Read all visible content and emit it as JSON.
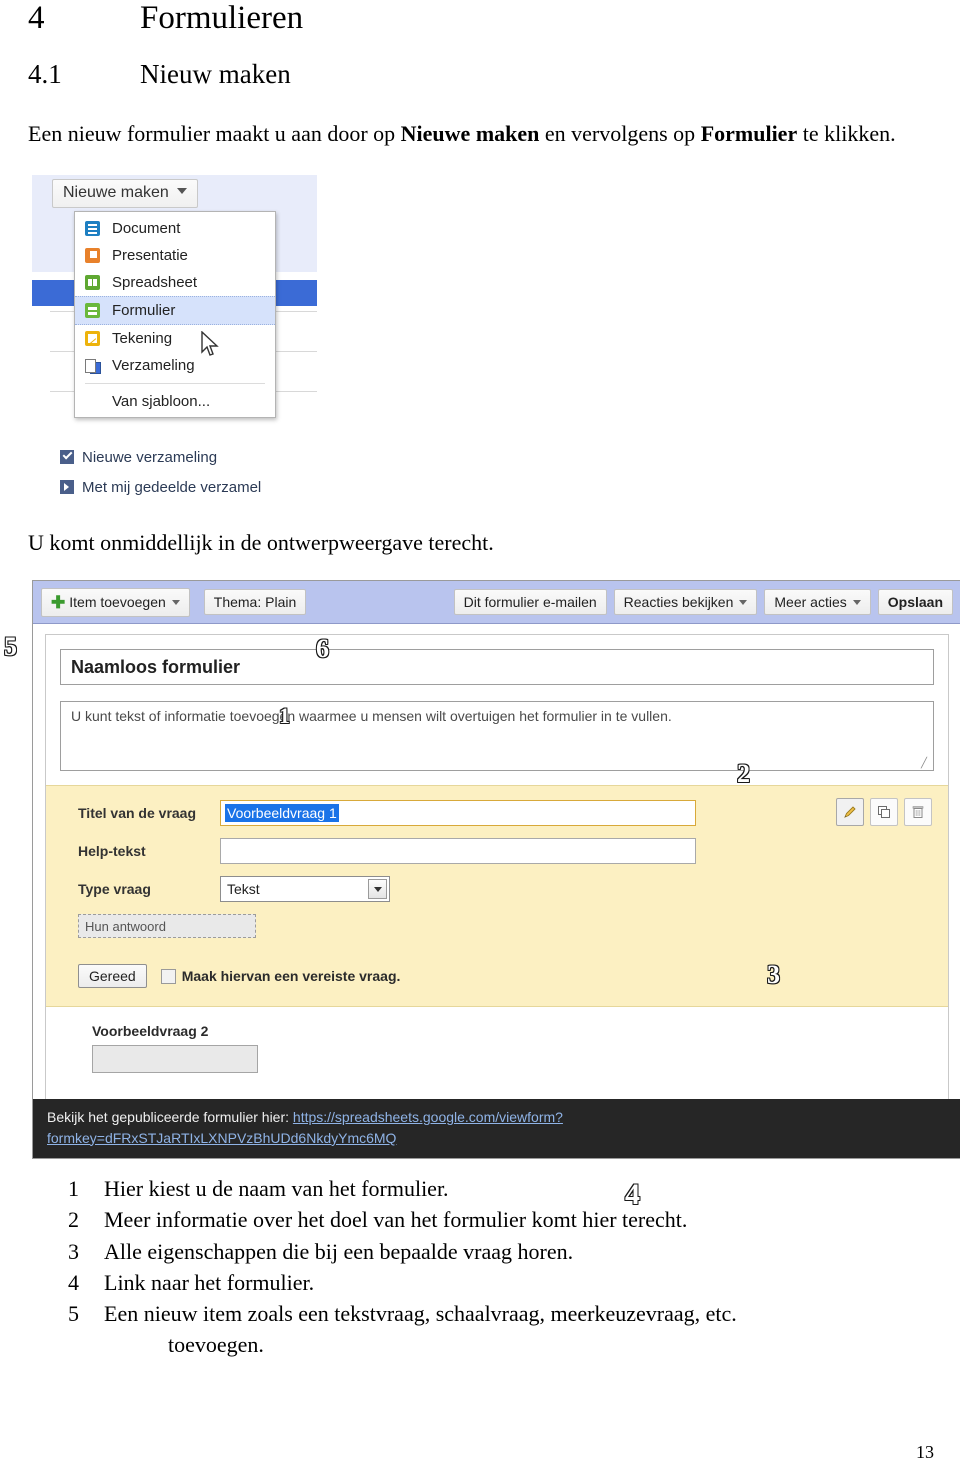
{
  "document": {
    "chapter_number": "4",
    "chapter_title": "Formulieren",
    "section_number": "4.1",
    "section_title": "Nieuw maken",
    "intro_part1": "Een nieuw formulier maakt u aan door op ",
    "intro_bold1": "Nieuwe maken",
    "intro_part2": " en vervolgens op ",
    "intro_bold2": "Formulier",
    "intro_part3": " te klikken.",
    "after_shot1": "U komt onmiddellijk in de ontwerpweergave terecht.",
    "page_number": "13"
  },
  "legend": {
    "items": [
      {
        "num": "1",
        "text": "Hier kiest u de naam van het formulier."
      },
      {
        "num": "2",
        "text": "Meer informatie over het doel van het formulier komt hier terecht."
      },
      {
        "num": "3",
        "text": "Alle eigenschappen die bij een bepaalde vraag horen."
      },
      {
        "num": "4",
        "text": "Link naar het formulier."
      },
      {
        "num": "5",
        "text": "Een nieuw item zoals een tekstvraag, schaalvraag, meerkeuzevraag, etc."
      }
    ],
    "item5_continuation": "toevoegen."
  },
  "callouts": {
    "one": "1",
    "two": "2",
    "three": "3",
    "four": "4",
    "five": "5",
    "six": "6"
  },
  "screenshot_menu": {
    "button_label": "Nieuwe maken",
    "items": [
      {
        "label": "Document",
        "icon": "document-icon",
        "selected": false
      },
      {
        "label": "Presentatie",
        "icon": "presentation-icon",
        "selected": false
      },
      {
        "label": "Spreadsheet",
        "icon": "spreadsheet-icon",
        "selected": false
      },
      {
        "label": "Formulier",
        "icon": "form-icon",
        "selected": true
      },
      {
        "label": "Tekening",
        "icon": "drawing-icon",
        "selected": false
      },
      {
        "label": "Verzameling",
        "icon": "collection-icon",
        "selected": false
      },
      {
        "label": "Van sjabloon...",
        "icon": "",
        "selected": false
      }
    ],
    "behind_item_1": "Nieuwe verzameling",
    "behind_item_2": "Met mij gedeelde verzamel",
    "colors": {
      "panel": "#e8ecfa",
      "highlight_bar": "#3b6bd6",
      "selected_item": "#d6e2fb"
    }
  },
  "screenshot_form": {
    "toolbar": {
      "add_item": "Item toevoegen",
      "theme": "Thema:  Plain",
      "email_form": "Dit formulier e-mailen",
      "view_responses": "Reacties bekijken",
      "more_actions": "Meer acties",
      "save": "Opslaan",
      "bar_color": "#b9c4ee"
    },
    "form_title": "Naamloos formulier",
    "form_description": "U kunt tekst of informatie toevoegen waarmee u mensen wilt overtuigen het formulier in te vullen.",
    "question_card": {
      "label_title": "Titel van de vraag",
      "value_title": "Voorbeeldvraag 1",
      "label_help": "Help-tekst",
      "value_help": "",
      "label_type": "Type vraag",
      "value_type": "Tekst",
      "answer_placeholder": "Hun antwoord",
      "done_button": "Gereed",
      "required_label": "Maak hiervan een vereiste vraag.",
      "required_checked": false,
      "tools": [
        "edit-pencil-icon",
        "duplicate-icon",
        "trash-icon"
      ],
      "background": "#fcf0c2"
    },
    "question_two": {
      "label": "Voorbeeldvraag 2",
      "value": ""
    },
    "footer": {
      "lead": "Bekijk het gepubliceerde formulier hier: ",
      "url_line1": "https://spreadsheets.google.com/viewform?",
      "url_line2": "formkey=dFRxSTJaRTIxLXNPVzBhUDd6NkdyYmc6MQ",
      "background": "#262626",
      "link_color": "#8fb3e6"
    }
  }
}
